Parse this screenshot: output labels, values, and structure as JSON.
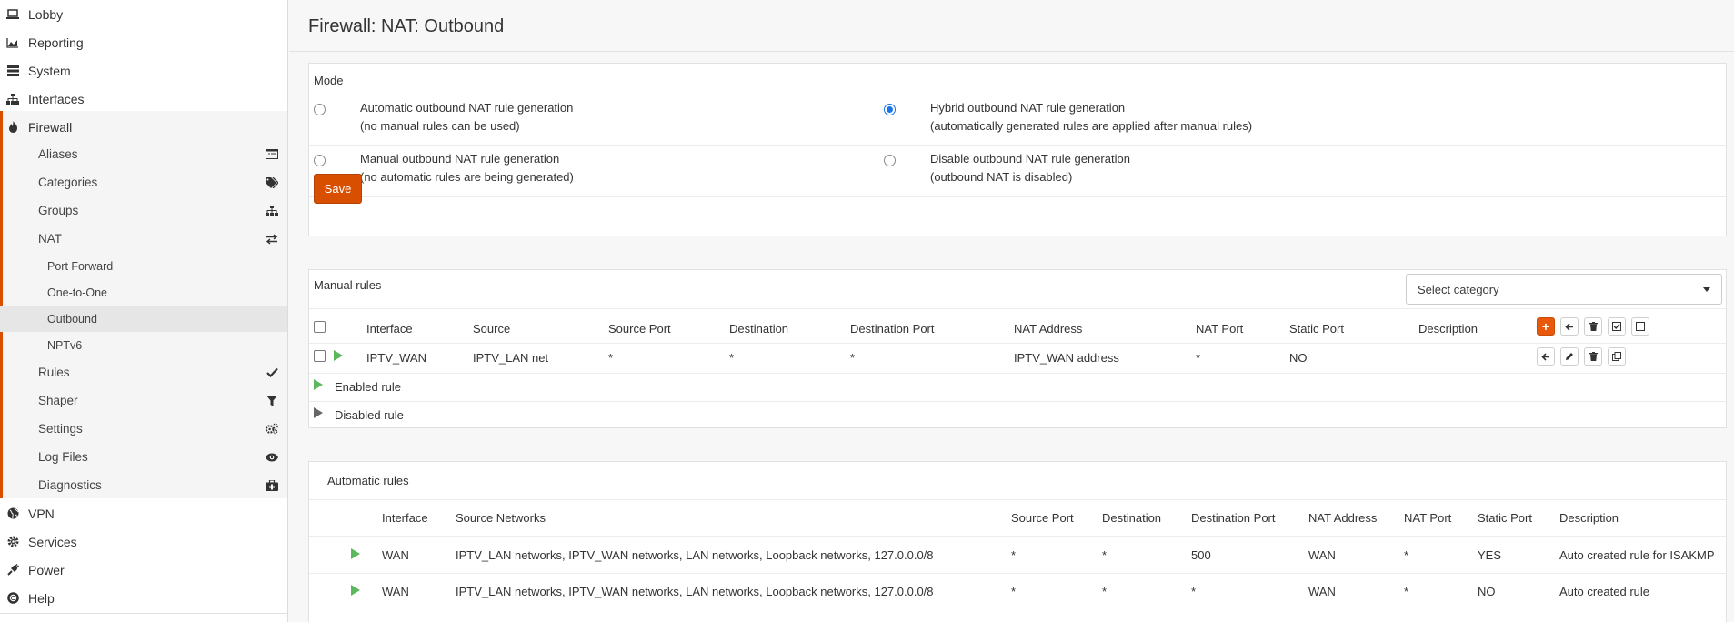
{
  "sidebar": {
    "top_items": [
      {
        "label": "Lobby",
        "icon": "laptop-icon"
      },
      {
        "label": "Reporting",
        "icon": "area-chart-icon"
      },
      {
        "label": "System",
        "icon": "server-icon"
      },
      {
        "label": "Interfaces",
        "icon": "sitemap-icon"
      },
      {
        "label": "Firewall",
        "icon": "fire-icon"
      }
    ],
    "firewall_items": [
      {
        "label": "Aliases",
        "icon": "list-alt-icon"
      },
      {
        "label": "Categories",
        "icon": "tags-icon"
      },
      {
        "label": "Groups",
        "icon": "sitemap-icon"
      },
      {
        "label": "NAT",
        "icon": "exchange-icon"
      }
    ],
    "nat_items": [
      {
        "label": "Port Forward"
      },
      {
        "label": "One-to-One"
      },
      {
        "label": "Outbound"
      },
      {
        "label": "NPTv6"
      }
    ],
    "firewall_items_after": [
      {
        "label": "Rules",
        "icon": "check-icon"
      },
      {
        "label": "Shaper",
        "icon": "filter-icon"
      },
      {
        "label": "Settings",
        "icon": "cogs-icon"
      },
      {
        "label": "Log Files",
        "icon": "eye-icon"
      },
      {
        "label": "Diagnostics",
        "icon": "medkit-icon"
      }
    ],
    "bottom_items": [
      {
        "label": "VPN",
        "icon": "globe-icon"
      },
      {
        "label": "Services",
        "icon": "cog-icon"
      },
      {
        "label": "Power",
        "icon": "plug-icon"
      },
      {
        "label": "Help",
        "icon": "life-ring-icon"
      }
    ]
  },
  "page": {
    "title": "Firewall: NAT: Outbound"
  },
  "mode": {
    "heading": "Mode",
    "options": [
      {
        "line1": "Automatic outbound NAT rule generation",
        "line2": "(no manual rules can be used)",
        "checked": false
      },
      {
        "line1": "Hybrid outbound NAT rule generation",
        "line2": "(automatically generated rules are applied after manual rules)",
        "checked": true
      },
      {
        "line1": "Manual outbound NAT rule generation",
        "line2": "(no automatic rules are being generated)",
        "checked": false
      },
      {
        "line1": "Disable outbound NAT rule generation",
        "line2": "(outbound NAT is disabled)",
        "checked": false
      }
    ],
    "save_label": "Save"
  },
  "manual": {
    "heading": "Manual rules",
    "category_placeholder": "Select category",
    "columns": [
      "Interface",
      "Source",
      "Source Port",
      "Destination",
      "Destination Port",
      "NAT Address",
      "NAT Port",
      "Static Port",
      "Description"
    ],
    "rows": [
      {
        "interface": "IPTV_WAN",
        "source": "IPTV_LAN net",
        "source_port": "*",
        "destination": "*",
        "destination_port": "*",
        "nat_address": "IPTV_WAN address",
        "nat_port": "*",
        "static_port": "NO",
        "description": ""
      }
    ],
    "legend_enabled": "Enabled rule",
    "legend_disabled": "Disabled rule"
  },
  "automatic": {
    "heading": "Automatic rules",
    "columns": [
      "Interface",
      "Source Networks",
      "Source Port",
      "Destination",
      "Destination Port",
      "NAT Address",
      "NAT Port",
      "Static Port",
      "Description"
    ],
    "rows": [
      {
        "interface": "WAN",
        "source": "IPTV_LAN networks, IPTV_WAN networks, LAN networks, Loopback networks, 127.0.0.0/8",
        "source_port": "*",
        "destination": "*",
        "destination_port": "500",
        "nat_address": "WAN",
        "nat_port": "*",
        "static_port": "YES",
        "description": "Auto created rule for ISAKMP"
      },
      {
        "interface": "WAN",
        "source": "IPTV_LAN networks, IPTV_WAN networks, LAN networks, Loopback networks, 127.0.0.0/8",
        "source_port": "*",
        "destination": "*",
        "destination_port": "*",
        "nat_address": "WAN",
        "nat_port": "*",
        "static_port": "NO",
        "description": "Auto created rule"
      }
    ]
  },
  "colors": {
    "accent": "#d94f00",
    "enabled": "#5cb85c",
    "radio": "#1a73e8"
  }
}
